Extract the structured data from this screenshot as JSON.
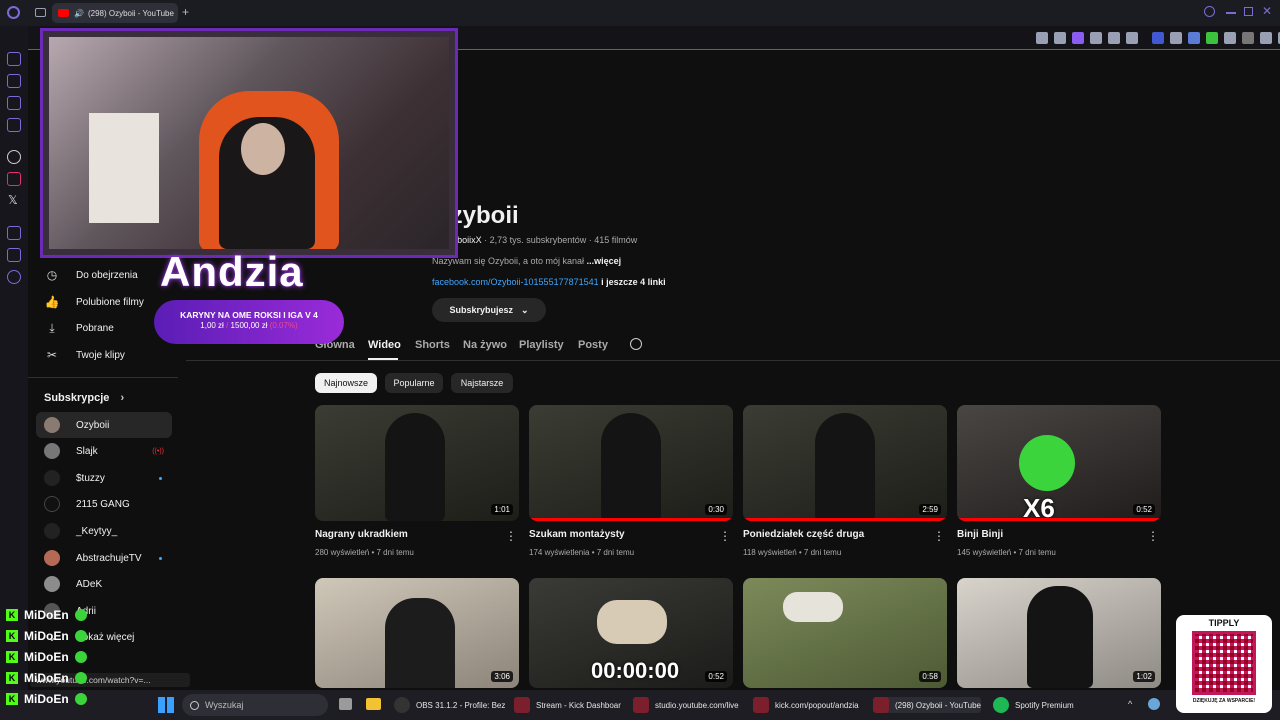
{
  "tabbar": {
    "tab_title": "(298) Ozyboii - YouTube"
  },
  "sidebar": {
    "items": [
      {
        "label": "Do obejrzenia",
        "icon": "clock-icon"
      },
      {
        "label": "Polubione filmy",
        "icon": "thumbs-up-icon"
      },
      {
        "label": "Pobrane",
        "icon": "download-icon"
      },
      {
        "label": "Twoje klipy",
        "icon": "scissors-icon"
      }
    ],
    "subs_header": "Subskrypcje",
    "subscriptions": [
      {
        "name": "Ozyboii",
        "status": "active"
      },
      {
        "name": "Slajk",
        "status": "live"
      },
      {
        "name": "$tuzzy",
        "status": "new"
      },
      {
        "name": "2115 GANG",
        "status": ""
      },
      {
        "name": "_Keytyy_",
        "status": ""
      },
      {
        "name": "AbstrachujeTV",
        "status": "new"
      },
      {
        "name": "ADeK",
        "status": ""
      },
      {
        "name": "Adrii",
        "status": ""
      }
    ],
    "show_more": "Pokaż więcej"
  },
  "channel": {
    "name": "Ozyboii",
    "handle": "@OzyboiixX",
    "meta": "· 2,73 tys. subskrybentów · 415 filmów",
    "description": "Nazywam się Ozyboii, a oto mój kanał",
    "more": "...więcej",
    "link": "facebook.com/Ozyboii-101555177871541",
    "more_links": "i jeszcze 4 linki",
    "subscribe_label": "Subskrybujesz",
    "tabs": [
      "Główna",
      "Wideo",
      "Shorts",
      "Na żywo",
      "Playlisty",
      "Posty"
    ],
    "active_tab": "Wideo",
    "chips": [
      "Najnowsze",
      "Popularne",
      "Najstarsze"
    ]
  },
  "videos": [
    {
      "title": "Nagrany ukradkiem",
      "views": "280 wyświetleń",
      "age": "7 dni temu",
      "duration": "1:01"
    },
    {
      "title": "Szukam montażysty",
      "views": "174 wyświetlenia",
      "age": "7 dni temu",
      "duration": "0:30"
    },
    {
      "title": "Poniedziałek część druga",
      "views": "118 wyświetleń",
      "age": "7 dni temu",
      "duration": "2:59"
    },
    {
      "title": "Binji Binji",
      "views": "145 wyświetleń",
      "age": "7 dni temu",
      "duration": "0:52"
    },
    {
      "title": "",
      "views": "",
      "age": "",
      "duration": "3:06"
    },
    {
      "title": "",
      "views": "",
      "age": "",
      "duration": "0:52"
    },
    {
      "title": "",
      "views": "",
      "age": "",
      "duration": "0:58"
    },
    {
      "title": "",
      "views": "",
      "age": "",
      "duration": "1:02"
    }
  ],
  "overlay": {
    "streamer_name": "Andzia",
    "goal_title": "KARYNY NA OME ROKSI I IGA V 4",
    "goal_current": "1,00 zł",
    "goal_target": "1500,00 zł",
    "goal_pct": "(0.07%)",
    "x6": "X6",
    "timer": "00:00:00",
    "tipply_title": "TIPPLY",
    "tipply_footer": "DZIĘKUJĘ ZA WSPARCIE!"
  },
  "chat": [
    {
      "user": "MiDoEn"
    },
    {
      "user": "MiDoEn"
    },
    {
      "user": "MiDoEn"
    },
    {
      "user": "MiDoEn"
    },
    {
      "user": "MiDoEn"
    }
  ],
  "status_url": "www.youtube.com/watch?v=...",
  "taskbar": {
    "search_placeholder": "Wyszukaj",
    "apps": [
      {
        "label": "OBS 31.1.2 - Profile: Bez"
      },
      {
        "label": "Stream - Kick Dashboar"
      },
      {
        "label": "studio.youtube.com/live"
      },
      {
        "label": "kick.com/popout/andzia"
      },
      {
        "label": "(298) Ozyboii - YouTube"
      },
      {
        "label": "Spotify Premium"
      }
    ]
  }
}
